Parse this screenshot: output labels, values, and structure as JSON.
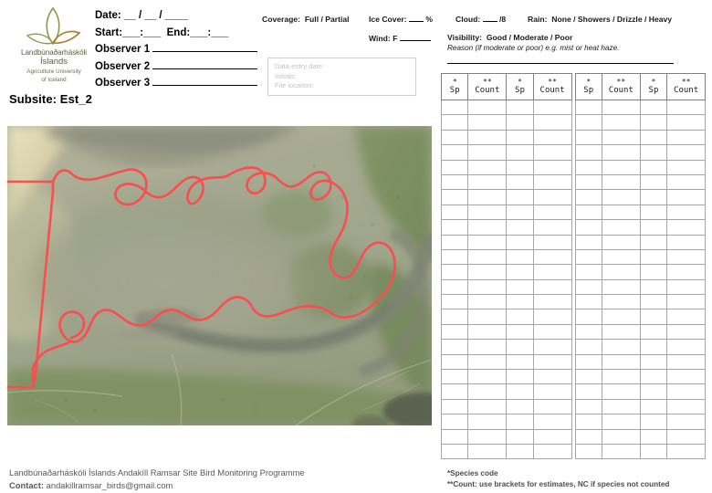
{
  "logo": {
    "name_is": "Landbúnaðarháskóli",
    "name_is2": "Íslands",
    "name_en1": "Agriculture University",
    "name_en2": "of Iceland",
    "mark": "leaf-logo"
  },
  "subsite": {
    "label": "Subsite: Est_2"
  },
  "header_left": {
    "date_label": "Date:",
    "date_value": "__ / __ / ____",
    "start_label": "Start:",
    "start_value": "___:___",
    "end_label": "End:",
    "end_value": "___:___",
    "observer1": "Observer 1",
    "observer2": "Observer 2",
    "observer3": "Observer 3"
  },
  "header_mid": {
    "coverage_label": "Coverage:",
    "coverage_options": "Full / Partial",
    "ice_label": "Ice Cover:",
    "ice_unit": "%",
    "wind_label": "Wind:",
    "wind_prefix": "F"
  },
  "data_entry": {
    "date_label": "Data entry date:",
    "initials_label": "Initials:",
    "file_label": "File location:"
  },
  "header_right": {
    "cloud_label": "Cloud:",
    "cloud_unit": "/8",
    "rain_label": "Rain:",
    "rain_options": "None / Showers / Drizzle / Heavy",
    "visibility_label": "Visibility:",
    "visibility_options": "Good / Moderate / Poor",
    "reason_note": "Reason (if moderate or poor) e.g. mist or heat haze."
  },
  "table": {
    "columns": [
      {
        "star": "*",
        "label": "Sp",
        "kind": "sp"
      },
      {
        "star": "**",
        "label": "Count",
        "kind": "count"
      },
      {
        "star": "*",
        "label": "Sp",
        "kind": "sp"
      },
      {
        "star": "**",
        "label": "Count",
        "kind": "count"
      }
    ],
    "blocks": 2,
    "rows": 24,
    "cells": []
  },
  "footnotes": {
    "species_code": "*Species code",
    "count_note": "**Count: use brackets for estimates, NC if species not counted"
  },
  "footer": {
    "line1": "Landbúnaðarháskóli Íslands Andakíll Ramsar Site Bird Monitoring Programme",
    "contact_label": "Contact:",
    "contact_email": "andakillramsar_birds@gmail.com"
  },
  "map": {
    "name": "aerial-subsite-map",
    "boundary_color": "#fb4d4d",
    "alt": "Aerial photograph of Andakíll estuary subsite Est_2 with red survey boundary"
  },
  "colors": {
    "boundary": "#fb4d4d",
    "table_border": "#a6a6a6",
    "table_outer": "#7f7f7f",
    "muted_text": "#595959",
    "placeholder": "#c2c2c2",
    "logo_green": "#5b5f3a"
  }
}
